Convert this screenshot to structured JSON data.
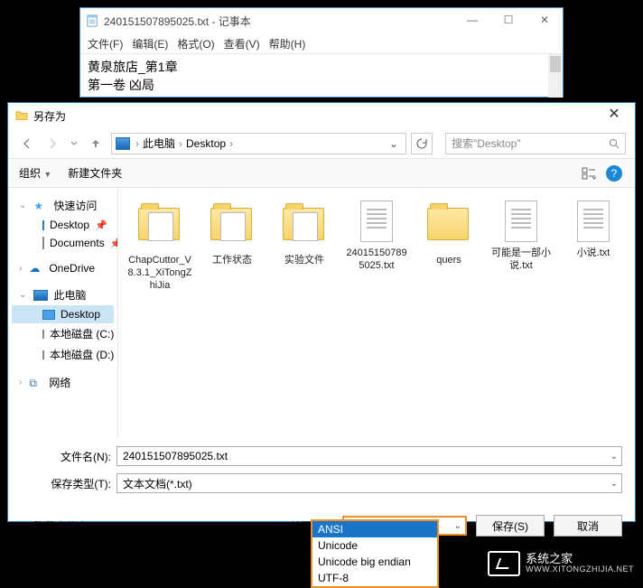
{
  "notepad": {
    "title": "240151507895025.txt - 记事本",
    "menus": {
      "file": "文件(F)",
      "edit": "编辑(E)",
      "format": "格式(O)",
      "view": "查看(V)",
      "help": "帮助(H)"
    },
    "line1": "黄泉旅店_第1章",
    "line2": "第一卷 凶局"
  },
  "saveas": {
    "title": "另存为",
    "path": {
      "root": "此电脑",
      "folder": "Desktop"
    },
    "search_placeholder": "搜索\"Desktop\"",
    "toolbar": {
      "organize": "组织",
      "newfolder": "新建文件夹"
    },
    "sidebar": {
      "quick": "快速访问",
      "desktop": "Desktop",
      "documents": "Documents",
      "onedrive": "OneDrive",
      "thispc": "此电脑",
      "desktop2": "Desktop",
      "drivec": "本地磁盘 (C:)",
      "drived": "本地磁盘 (D:)",
      "network": "网络"
    },
    "files": [
      {
        "name": "ChapCuttor_V8.3.1_XiTongZhiJia",
        "type": "folder-paper"
      },
      {
        "name": "工作状态",
        "type": "folder-paper"
      },
      {
        "name": "实验文件",
        "type": "folder-paper"
      },
      {
        "name": "240151507895025.txt",
        "type": "txt"
      },
      {
        "name": "quers",
        "type": "folder"
      },
      {
        "name": "可能是一部小说.txt",
        "type": "txt"
      },
      {
        "name": "小说.txt",
        "type": "txt"
      }
    ],
    "filename_label": "文件名(N):",
    "filename_value": "240151507895025.txt",
    "filetype_label": "保存类型(T):",
    "filetype_value": "文本文档(*.txt)",
    "hide_folders": "隐藏文件夹",
    "encoding_label": "编码(E):",
    "encoding_value": "ANSI",
    "encoding_options": [
      "ANSI",
      "Unicode",
      "Unicode big endian",
      "UTF-8"
    ],
    "save_btn": "保存(S)",
    "cancel_btn": "取消"
  },
  "watermark": {
    "brand": "系统之家",
    "url": "WWW.XITONGZHIJIA.NET"
  }
}
